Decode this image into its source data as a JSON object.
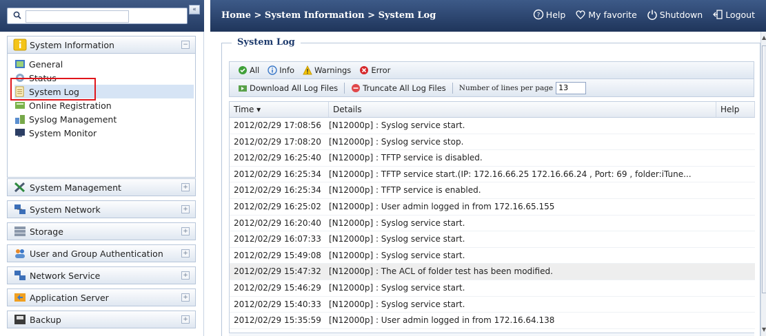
{
  "search": {
    "placeholder": "",
    "value": ""
  },
  "sidebar": {
    "collapse_glyph": "«",
    "system_information": {
      "label": "System Information",
      "items": [
        {
          "label": "General",
          "icon": "general-icon"
        },
        {
          "label": "Status",
          "icon": "status-icon"
        },
        {
          "label": "System Log",
          "icon": "system-log-icon",
          "selected": true
        },
        {
          "label": "Online Registration",
          "icon": "registration-icon"
        },
        {
          "label": "Syslog Management",
          "icon": "syslog-icon"
        },
        {
          "label": "System Monitor",
          "icon": "monitor-icon"
        }
      ]
    },
    "panels": [
      {
        "label": "System Management",
        "icon": "tools-icon"
      },
      {
        "label": "System Network",
        "icon": "network-icon"
      },
      {
        "label": "Storage",
        "icon": "storage-icon"
      },
      {
        "label": "User and Group Authentication",
        "icon": "users-icon"
      },
      {
        "label": "Network Service",
        "icon": "network-service-icon"
      },
      {
        "label": "Application Server",
        "icon": "app-server-icon"
      },
      {
        "label": "Backup",
        "icon": "backup-icon"
      }
    ]
  },
  "header": {
    "breadcrumb": "Home > System Information > System Log",
    "links": [
      {
        "label": "Help",
        "icon": "help-icon"
      },
      {
        "label": "My favorite",
        "icon": "heart-icon"
      },
      {
        "label": "Shutdown",
        "icon": "power-icon"
      },
      {
        "label": "Logout",
        "icon": "logout-icon"
      }
    ]
  },
  "main": {
    "title": "System Log",
    "filters": [
      {
        "label": "All",
        "icon": "all-icon"
      },
      {
        "label": "Info",
        "icon": "info-icon"
      },
      {
        "label": "Warnings",
        "icon": "warning-icon"
      },
      {
        "label": "Error",
        "icon": "error-icon"
      }
    ],
    "actions": {
      "download": "Download All Log Files",
      "truncate": "Truncate All Log Files",
      "lines_label": "Number of lines per page",
      "lines_value": "13"
    },
    "columns": {
      "time": "Time ▾",
      "details": "Details",
      "help": "Help"
    },
    "rows": [
      {
        "time": "2012/02/29 17:08:56",
        "details": "[N12000p] : Syslog service start."
      },
      {
        "time": "2012/02/29 17:08:20",
        "details": "[N12000p] : Syslog service stop."
      },
      {
        "time": "2012/02/29 16:25:40",
        "details": "[N12000p] : TFTP service is disabled."
      },
      {
        "time": "2012/02/29 16:25:34",
        "details": "[N12000p] : TFTP service start.(IP: 172.16.66.25 172.16.66.24 , Port: 69 , folder:iTune..."
      },
      {
        "time": "2012/02/29 16:25:34",
        "details": "[N12000p] : TFTP service is enabled."
      },
      {
        "time": "2012/02/29 16:25:02",
        "details": "[N12000p] : User admin logged in from 172.16.65.155"
      },
      {
        "time": "2012/02/29 16:20:40",
        "details": "[N12000p] : Syslog service start."
      },
      {
        "time": "2012/02/29 16:07:33",
        "details": "[N12000p] : Syslog service start."
      },
      {
        "time": "2012/02/29 15:49:08",
        "details": "[N12000p] : Syslog service start."
      },
      {
        "time": "2012/02/29 15:47:32",
        "details": "[N12000p] : The ACL of folder test has been modified.",
        "highlight": true
      },
      {
        "time": "2012/02/29 15:46:29",
        "details": "[N12000p] : Syslog service start."
      },
      {
        "time": "2012/02/29 15:40:33",
        "details": "[N12000p] : Syslog service start."
      },
      {
        "time": "2012/02/29 15:35:59",
        "details": "[N12000p] : User admin logged in from 172.16.64.138"
      }
    ]
  }
}
